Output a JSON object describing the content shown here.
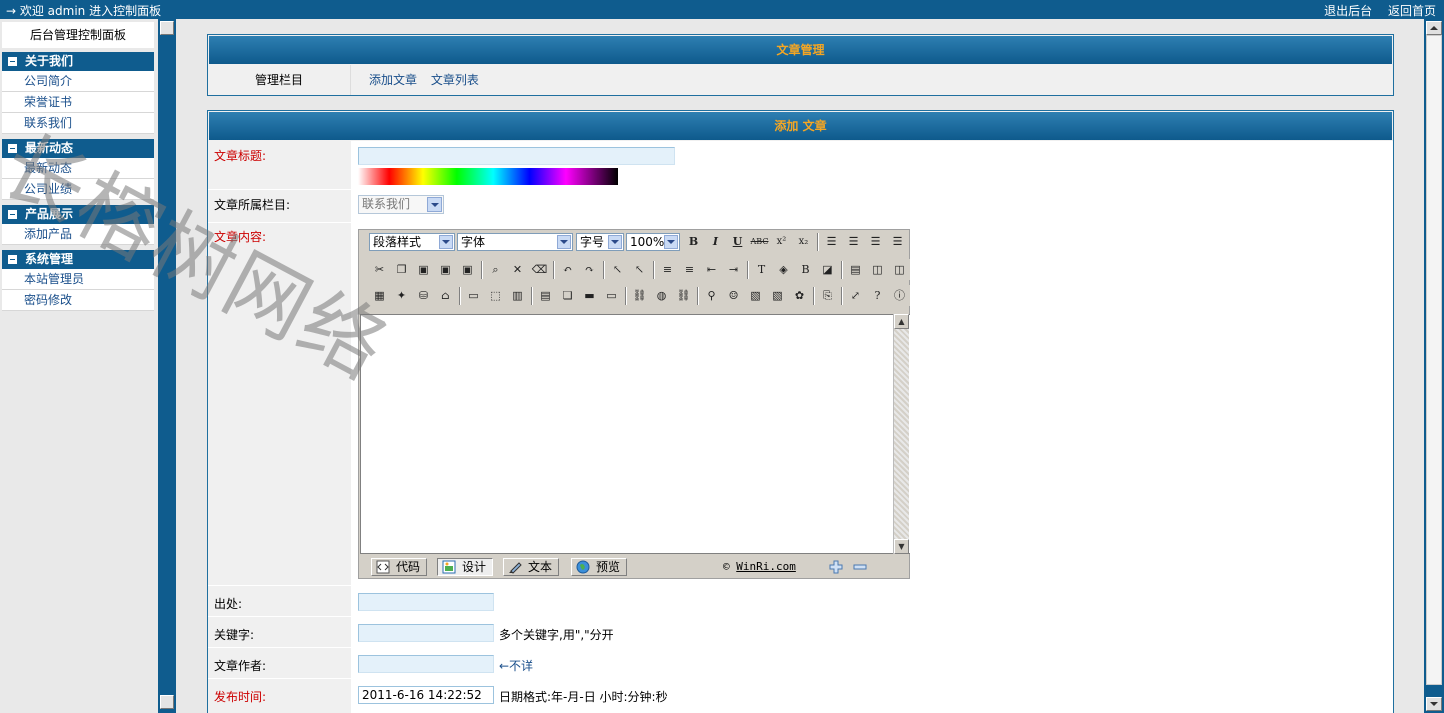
{
  "topbar": {
    "welcome": "→ 欢迎  admin 进入控制面板",
    "logout": "退出后台",
    "home": "返回首页"
  },
  "sidebar": {
    "panel_title": "后台管理控制面板",
    "groups": [
      {
        "title": "关于我们",
        "items": [
          "公司简介",
          "荣誉证书",
          "联系我们"
        ]
      },
      {
        "title": "最新动态",
        "items": [
          "最新动态",
          "公司业绩"
        ]
      },
      {
        "title": "产品展示",
        "items": [
          "添加产品"
        ]
      },
      {
        "title": "系统管理",
        "items": [
          "本站管理员",
          "密码修改"
        ]
      }
    ]
  },
  "article_mgmt": {
    "title": "文章管理",
    "label": "管理栏目",
    "add": "添加文章",
    "list": "文章列表"
  },
  "add_form": {
    "title": "添加 文章",
    "title_label": "文章标题:",
    "column_label": "文章所属栏目:",
    "column_value": "联系我们",
    "content_label": "文章内容:",
    "source_label": "出处:",
    "keywords_label": "关键字:",
    "keywords_hint": "多个关键字,用\",\"分开",
    "author_label": "文章作者:",
    "author_hint": "←不详",
    "date_label": "发布时间:",
    "date_value": "2011-6-16 14:22:52",
    "date_hint": "日期格式:年-月-日 小时:分钟:秒"
  },
  "editor": {
    "paragraph_style": "段落样式",
    "font": "字体",
    "font_size": "字号",
    "zoom": "100%",
    "modes": [
      "代码",
      "设计",
      "文本",
      "预览"
    ],
    "brand_prefix": "©",
    "brand": "WinRi.com"
  },
  "watermark": "长榕树网络"
}
